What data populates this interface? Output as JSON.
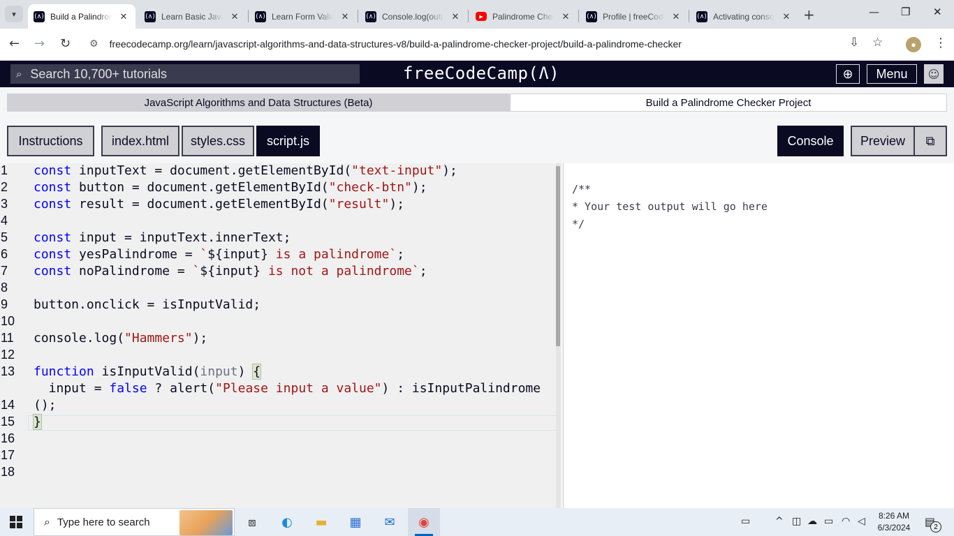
{
  "browser": {
    "tabs": [
      {
        "label": "Build a Palindrome Checker Project",
        "favicon": "fcc-icon",
        "active": true
      },
      {
        "label": "Learn Basic JavaScript",
        "favicon": "fcc-icon",
        "active": false
      },
      {
        "label": "Learn Form Validation",
        "favicon": "fcc-icon",
        "active": false
      },
      {
        "label": "Console.log(output)",
        "favicon": "fcc-icon",
        "active": false
      },
      {
        "label": "Palindrome Checker",
        "favicon": "youtube-icon",
        "active": false
      },
      {
        "label": "Profile | freeCodeCamp",
        "favicon": "fcc-icon",
        "active": false
      },
      {
        "label": "Activating console",
        "favicon": "fcc-icon",
        "active": false
      }
    ],
    "url": "freecodecamp.org/learn/javascript-algorithms-and-data-structures-v8/build-a-palindrome-checker-project/build-a-palindrome-checker"
  },
  "fcc_nav": {
    "search_placeholder": "Search 10,700+ tutorials",
    "logo": "freeCodeCamp(Ʌ)",
    "menu_label": "Menu"
  },
  "breadcrumb": {
    "course": "JavaScript Algorithms and Data Structures (Beta)",
    "project": "Build a Palindrome Checker Project"
  },
  "editor_tabs": [
    {
      "label": "Instructions",
      "active": false
    },
    {
      "label": "index.html",
      "active": false
    },
    {
      "label": "styles.css",
      "active": false
    },
    {
      "label": "script.js",
      "active": true
    }
  ],
  "right_tabs": {
    "console": "Console",
    "preview": "Preview"
  },
  "editor": {
    "line_numbers": [
      "1",
      "2",
      "3",
      "4",
      "5",
      "6",
      "7",
      "8",
      "9",
      "10",
      "11",
      "12",
      "13",
      "",
      "14",
      "15",
      "16",
      "17",
      "18"
    ],
    "code_lines": [
      "const inputText = document.getElementById(\"text-input\");",
      "const button = document.getElementById(\"check-btn\");",
      "const result = document.getElementById(\"result\");",
      "",
      "const input = inputText.innerText;",
      "const yesPalindrome = `${input} is a palindrome`;",
      "const noPalindrome = `${input} is not a palindrome`;",
      "",
      "button.onclick = isInputValid;",
      "",
      "console.log(\"Hammers\");",
      "",
      "function isInputValid(input) {",
      "  input = false ? alert(\"Please input a value\") : isInputPalindrome",
      "();",
      "}",
      "",
      "",
      ""
    ]
  },
  "console": {
    "output": "/**\n* Your test output will go here\n*/"
  },
  "taskbar": {
    "search_placeholder": "Type here to search",
    "time": "8:26 AM",
    "date": "6/3/2024",
    "notification_count": "2"
  }
}
